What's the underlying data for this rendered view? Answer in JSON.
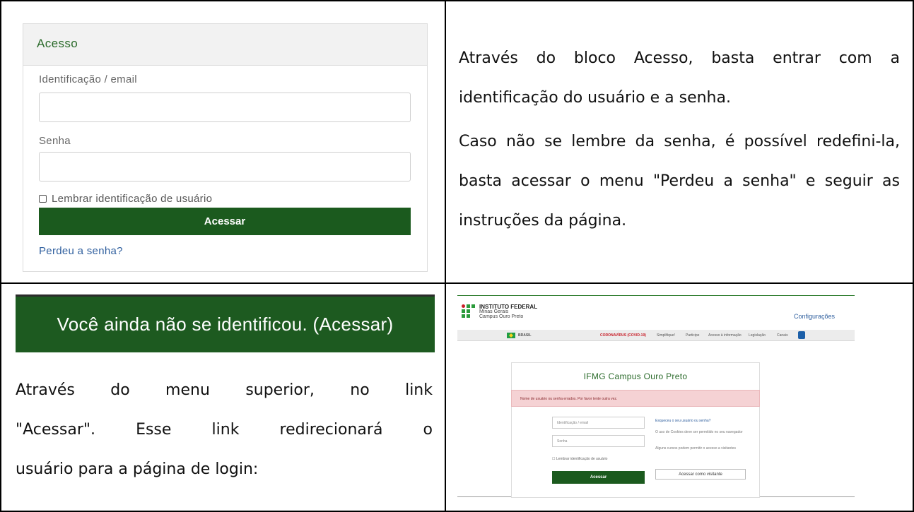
{
  "login_block": {
    "title": "Acesso",
    "identification_label": "Identificação / email",
    "password_label": "Senha",
    "remember_label": "Lembrar identificação de usuário",
    "submit_label": "Acessar",
    "lost_password_link": "Perdeu a senha?",
    "colors": {
      "button": "#1b5a1e",
      "title": "#2a6a2a",
      "link": "#2f5f9e"
    }
  },
  "top_right_text": {
    "paragraph1": "Através do bloco Acesso, basta entrar com a identificação do usuário e a senha.",
    "paragraph2": "Caso não se lembre da senha, é possível redefini-la, basta acessar o menu \"Perdeu a senha\" e seguir as instruções da página."
  },
  "banner": {
    "text": "Você ainda não se identificou. (Acessar)",
    "color": "#1d5a20"
  },
  "bottom_left_text": {
    "line1": "Através do menu superior, no link",
    "line2": "\"Acessar\". Esse link redirecionará o",
    "line3": "usuário para a página de login:"
  },
  "mini_screenshot": {
    "logo_title": "INSTITUTO FEDERAL",
    "logo_sub1": "Minas Gerais",
    "logo_sub2": "Campus Ouro Preto",
    "config_link": "Configurações",
    "govbar": {
      "brasil": "BRASIL",
      "covid": "CORONAVÍRUS (COVID-19)",
      "items": [
        "Simplifique!",
        "Participe",
        "Acesso à informação",
        "Legislação",
        "Canais"
      ]
    },
    "login_title": "IFMG Campus Ouro Preto",
    "error_message": "Nome de usuário ou senha errados. Por favor tente outra vez.",
    "ident_placeholder": "Identificação / email",
    "password_placeholder": "Senha",
    "remember_label": "Lembrar identificação de usuário",
    "submit_label": "Acessar",
    "forgot_link": "Esqueceu o seu usuário ou senha?",
    "cookies_note": "O uso de Cookies deve ser permitido no seu navegador",
    "guest_note": "Alguns cursos podem permitir o acesso a visitantes",
    "guest_button": "Acessar como visitante"
  }
}
